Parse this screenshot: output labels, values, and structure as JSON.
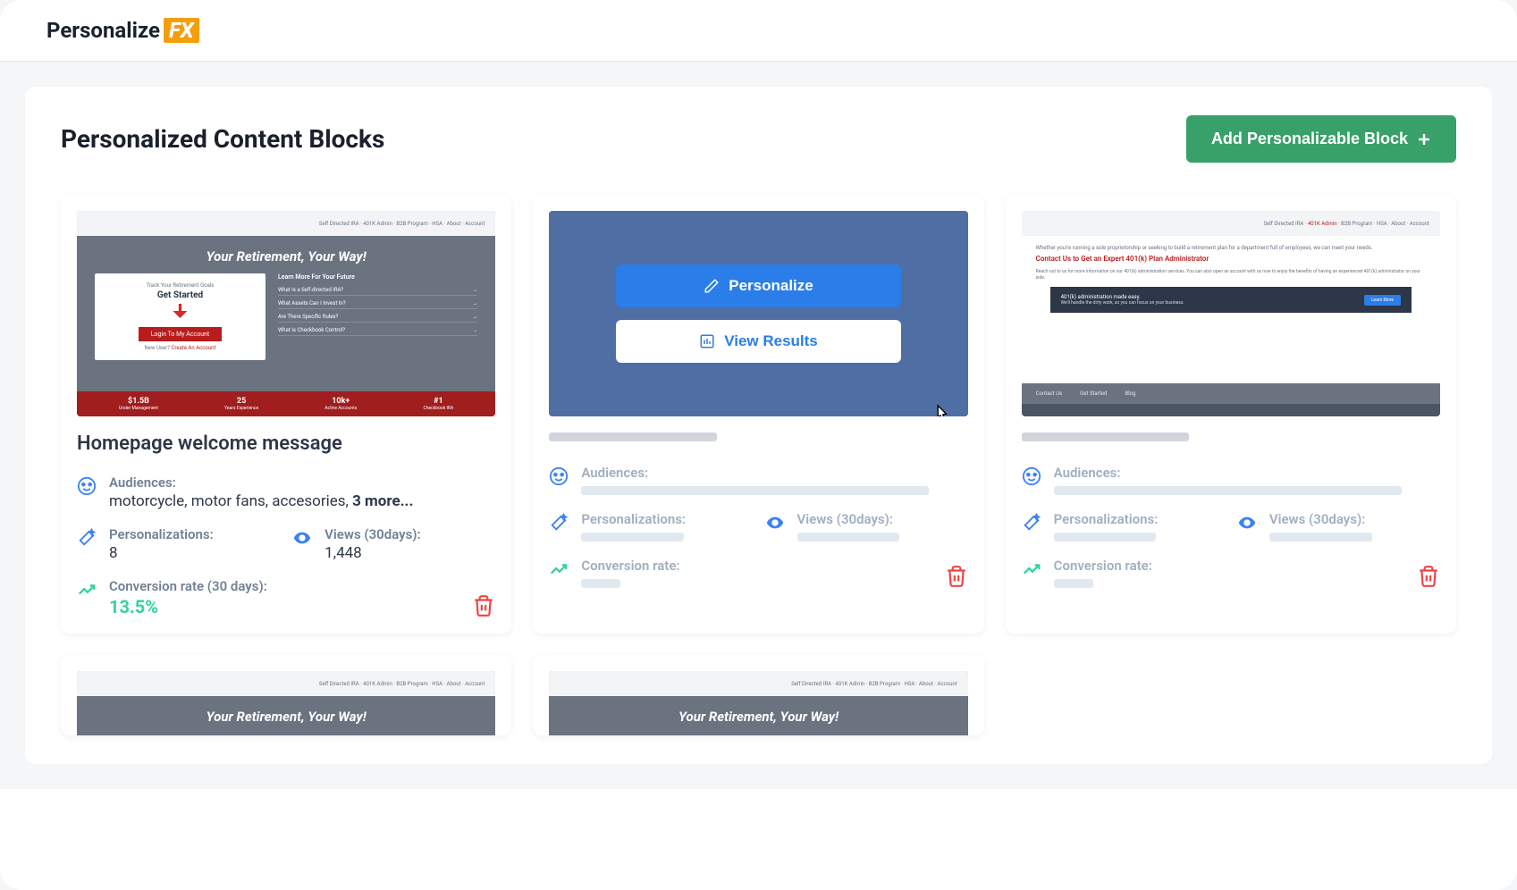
{
  "logo": {
    "text": "Personalize",
    "fx": "FX"
  },
  "page": {
    "title": "Personalized Content Blocks",
    "add_button": "Add Personalizable Block"
  },
  "overlay": {
    "personalize": "Personalize",
    "view_results": "View Results"
  },
  "preview1": {
    "hero_title": "Your Retirement, Your Way!",
    "get_started_small": "Track Your Retirement Goals",
    "get_started": "Get Started",
    "login": "Login To My Account",
    "new_user": "New User?",
    "create_account": "Create An Account",
    "links_header": "Learn More For Your Future",
    "link1": "What is a Self-directed IRA?",
    "link2": "What Assets Can I Invest In?",
    "link3": "Are There Specific Rules?",
    "link4": "What Is Checkbook Control?",
    "stat1_v": "$1.5B",
    "stat1_l": "Under Management",
    "stat2_v": "25",
    "stat2_l": "Years Experience",
    "stat3_v": "10k+",
    "stat3_l": "Active Accounts",
    "stat4_v": "#1",
    "stat4_l": "Checkbook IRA"
  },
  "preview3": {
    "intro": "Whether you're running a sole proprietorship or seeking to build a retirement plan for a department full of employees, we can meet your needs.",
    "headline": "Contact Us to Get an Expert 401(k) Plan Administrator",
    "body": "Reach out to us for more information on our 401(k) administration services. You can also open an account with us now to enjoy the benefits of having an experienced 401(k) administrator on your side.",
    "banner_title": "401(k) administration made easy.",
    "banner_sub": "We'll handle the dirty work, so you can focus on your business.",
    "banner_btn": "Learn More",
    "footer1": "Contact Us",
    "footer2": "Get Started",
    "footer3": "Blog"
  },
  "cards": {
    "card1": {
      "title": "Homepage welcome message",
      "audiences_label": "Audiences:",
      "audiences_value": "motorcycle, motor fans, accesories, ",
      "audiences_more": "3 more...",
      "personalizations_label": "Personalizations:",
      "personalizations_value": "8",
      "views_label": "Views (30days):",
      "views_value": "1,448",
      "conversion_label": "Conversion rate (30 days):",
      "conversion_value": "13.5%"
    },
    "card2": {
      "audiences_label": "Audiences:",
      "personalizations_label": "Personalizations:",
      "views_label": "Views (30days):",
      "conversion_label": "Conversion rate:"
    },
    "card3": {
      "audiences_label": "Audiences:",
      "personalizations_label": "Personalizations:",
      "views_label": "Views (30days):",
      "conversion_label": "Conversion rate:"
    }
  },
  "bottom_preview": {
    "hero_title": "Your Retirement, Your Way!"
  }
}
